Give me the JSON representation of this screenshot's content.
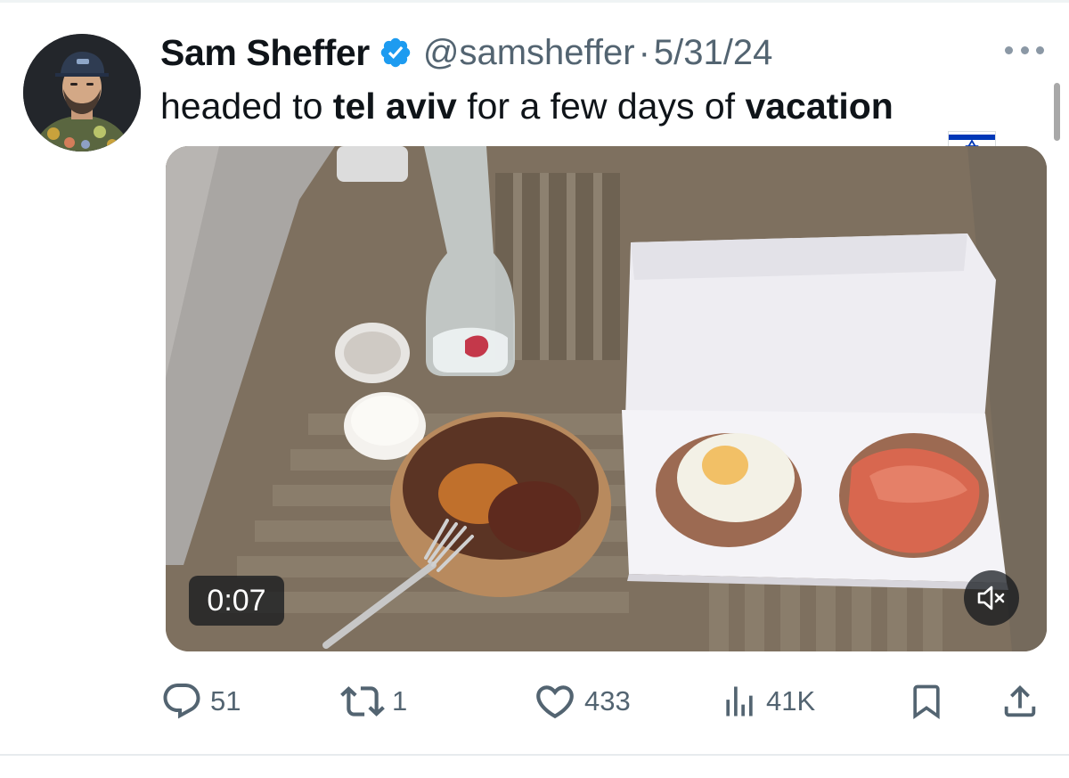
{
  "tweet": {
    "author": {
      "display_name": "Sam Sheffer",
      "handle": "@samsheffer",
      "verified": true,
      "avatar_icon": "user-avatar"
    },
    "separator": "·",
    "date": "5/31/24",
    "text_parts": [
      {
        "text": "headed to ",
        "bold": false
      },
      {
        "text": "tel aviv",
        "bold": true
      },
      {
        "text": " for a few days of ",
        "bold": false
      },
      {
        "text": "vacation",
        "bold": true
      }
    ],
    "emoji": "israel-flag-emoji",
    "media": {
      "type": "video",
      "timecode": "0:07",
      "muted": true,
      "mute_icon": "speaker-muted-icon"
    },
    "actions": {
      "replies": "51",
      "reposts": "1",
      "likes": "433",
      "views": "41K"
    }
  },
  "icons": {
    "reply": "speech-bubble-icon",
    "repost": "repost-arrows-icon",
    "like": "heart-icon",
    "views": "bar-chart-icon",
    "bookmark": "bookmark-icon",
    "share": "share-upload-icon",
    "more": "ellipsis-icon",
    "verified": "verified-badge-icon"
  },
  "colors": {
    "text_primary": "#0f1419",
    "text_secondary": "#536471",
    "verified_blue": "#1d9bf0",
    "flag_blue": "#0038b8"
  }
}
